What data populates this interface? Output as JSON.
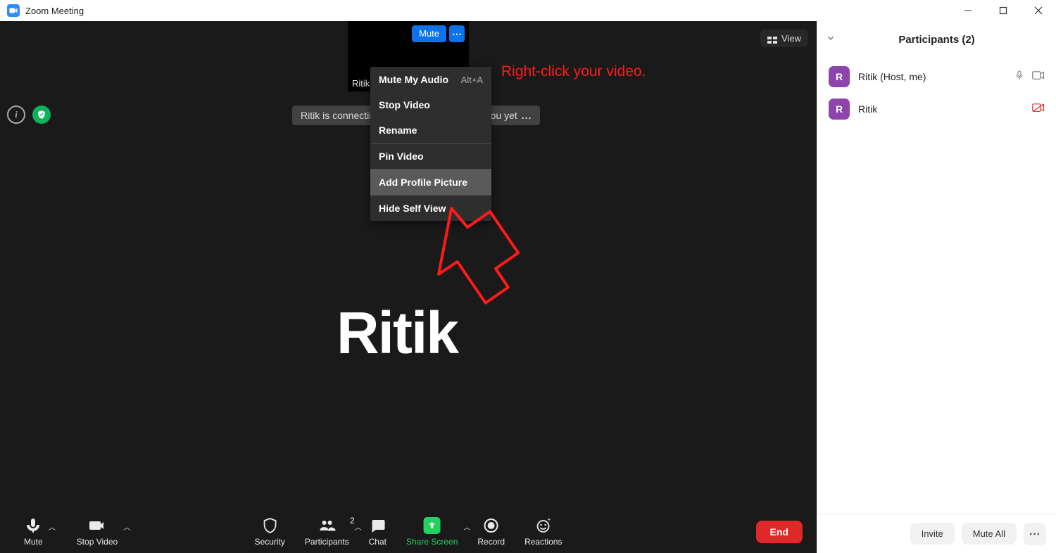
{
  "titlebar": {
    "title": "Zoom Meeting"
  },
  "selfVideo": {
    "muteLabel": "Mute",
    "name": "Ritik"
  },
  "viewBtn": "View",
  "toast": "Ritik is connecting to audio and can't hear you yet",
  "contextMenu": {
    "muteAudio": "Mute My Audio",
    "muteAudioShortcut": "Alt+A",
    "stopVideo": "Stop Video",
    "rename": "Rename",
    "pinVideo": "Pin Video",
    "addProfile": "Add Profile Picture",
    "hideSelf": "Hide Self View"
  },
  "annotation": "Right-click your video.",
  "mainName": "Ritik",
  "toolbar": {
    "mute": "Mute",
    "stopVideo": "Stop Video",
    "security": "Security",
    "participants": "Participants",
    "participantsBadge": "2",
    "chat": "Chat",
    "shareScreen": "Share Screen",
    "record": "Record",
    "reactions": "Reactions",
    "end": "End"
  },
  "participantsPanel": {
    "title": "Participants (2)",
    "rows": [
      {
        "initial": "R",
        "name": "Ritik (Host, me)",
        "camOff": false
      },
      {
        "initial": "R",
        "name": "Ritik",
        "camOff": true
      }
    ],
    "invite": "Invite",
    "muteAll": "Mute All"
  }
}
